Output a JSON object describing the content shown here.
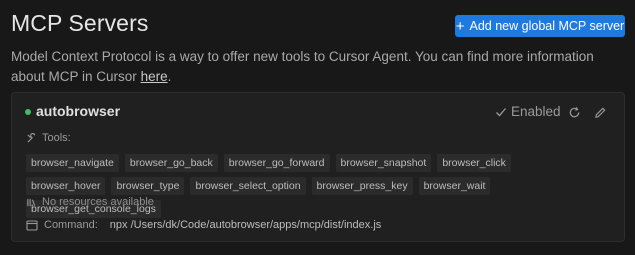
{
  "header": {
    "title": "MCP Servers",
    "add_button_label": "Add new global MCP server",
    "description_text": "Model Context Protocol is a way to offer new tools to Cursor Agent. You can find more information about MCP in Cursor ",
    "description_link": "here",
    "description_end": "."
  },
  "server": {
    "name": "autobrowser",
    "status_color": "#3fbf5f",
    "enabled_label": "Enabled",
    "tools_label": "Tools:",
    "tools": [
      "browser_navigate",
      "browser_go_back",
      "browser_go_forward",
      "browser_snapshot",
      "browser_click",
      "browser_hover",
      "browser_type",
      "browser_select_option",
      "browser_press_key",
      "browser_wait",
      "browser_get_console_logs"
    ],
    "no_resources_label": "No resources available",
    "command_label": "Command:",
    "command_value": "npx /Users/dk/Code/autobrowser/apps/mcp/dist/index.js"
  },
  "colors": {
    "accent": "#1f7ae0",
    "background": "#181818",
    "card": "#202020"
  }
}
